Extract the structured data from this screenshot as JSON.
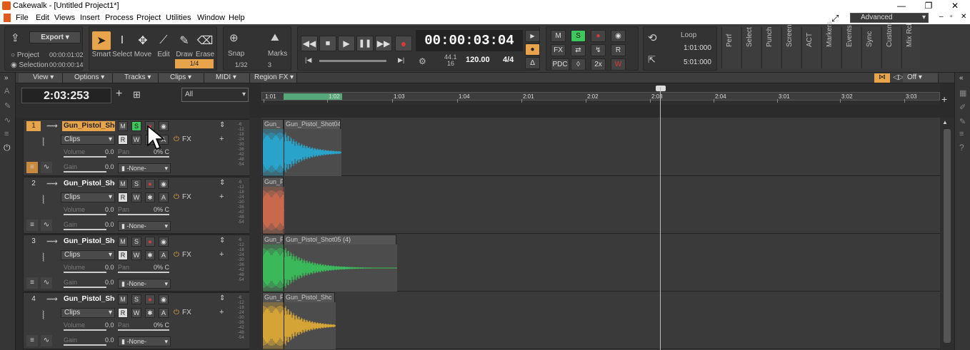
{
  "window": {
    "title": "Cakewalk - [Untitled Project1*]",
    "workspace": "Advanced"
  },
  "menu": [
    "File",
    "Edit",
    "Views",
    "Insert",
    "Process",
    "Project",
    "Utilities",
    "Window",
    "Help"
  ],
  "control_bar": {
    "export_label": "Export",
    "project_label": "Project",
    "project_time": "00:00:01:02",
    "selection_label": "Selection",
    "selection_time": "00:00:00:14",
    "tools": [
      "Smart",
      "Select",
      "Move",
      "Edit",
      "Draw",
      "Erase"
    ],
    "snap_value": "1/4",
    "snap_label": "Snap",
    "marks_label": "Marks",
    "snap_sub": "1/32",
    "snap_count": "3",
    "time": "00:00:03:04",
    "sample_rate": "44.1",
    "bit_depth": "16",
    "tempo": "120.00",
    "meter": "4/4",
    "mix_buttons": [
      "M",
      "S",
      "FX",
      "PDC",
      "2x"
    ],
    "loop_label": "Loop",
    "loop_start": "1:01:000",
    "loop_end": "5:01:000",
    "screenset_buttons": [
      "Perf",
      "Select",
      "Punch",
      "Screen",
      "ACT",
      "Markers",
      "Events",
      "Sync",
      "Custom",
      "Mix Rcl"
    ]
  },
  "view_menu": [
    "View",
    "Options",
    "Tracks",
    "Clips",
    "MIDI",
    "Region FX"
  ],
  "clips_view_time": "2:03:253",
  "filter_value": "All",
  "off_label": "Off",
  "ruler_ticks": [
    "1:01",
    "1:02",
    "1:03",
    "1:04",
    "2:01",
    "2:02",
    "2:03",
    "2:04",
    "3:01",
    "3:02",
    "3:03"
  ],
  "tracks": [
    {
      "num": "1",
      "name": "Gun_Pistol_Shot",
      "clips_label": "Clips",
      "volume_label": "Volume",
      "volume": "0.0",
      "pan_label": "Pan",
      "pan": "0% C",
      "gain_label": "Gain",
      "gain": "0.0",
      "fx_label": "FX",
      "input": "-None-",
      "color": "#29a3c9",
      "clip_labels": [
        "Gun_",
        "Gun_Pistol_Shot04"
      ]
    },
    {
      "num": "2",
      "name": "Gun_Pistol_Shot",
      "clips_label": "Clips",
      "volume_label": "Volume",
      "volume": "0.0",
      "pan_label": "Pan",
      "pan": "0% C",
      "gain_label": "Gain",
      "gain": "0.0",
      "fx_label": "FX",
      "input": "-None-",
      "color": "#c8694e",
      "clip_labels": [
        "Gun_P"
      ]
    },
    {
      "num": "3",
      "name": "Gun_Pistol_Shot",
      "clips_label": "Clips",
      "volume_label": "Volume",
      "volume": "0.0",
      "pan_label": "Pan",
      "pan": "0% C",
      "gain_label": "Gain",
      "gain": "0.0",
      "fx_label": "FX",
      "input": "-None-",
      "color": "#3bb85a",
      "clip_labels": [
        "Gun_P",
        "Gun_Pistol_Shot05 (4)"
      ]
    },
    {
      "num": "4",
      "name": "Gun_Pistol_Shot",
      "clips_label": "Clips",
      "volume_label": "Volume",
      "volume": "0.0",
      "pan_label": "Pan",
      "pan": "0% C",
      "gain_label": "Gain",
      "gain": "0.0",
      "fx_label": "FX",
      "input": "-None-",
      "color": "#d4a437",
      "clip_labels": [
        "Gun_P",
        "Gun_Pistol_Shc"
      ]
    }
  ],
  "meter_scale": [
    "-6",
    "-12",
    "-18",
    "-24",
    "-30",
    "-36",
    "-42",
    "-48",
    "-54"
  ],
  "colors": {
    "accent_orange": "#e8a44a",
    "solo_green": "#3cc85a",
    "record_red": "#d93a3a"
  }
}
